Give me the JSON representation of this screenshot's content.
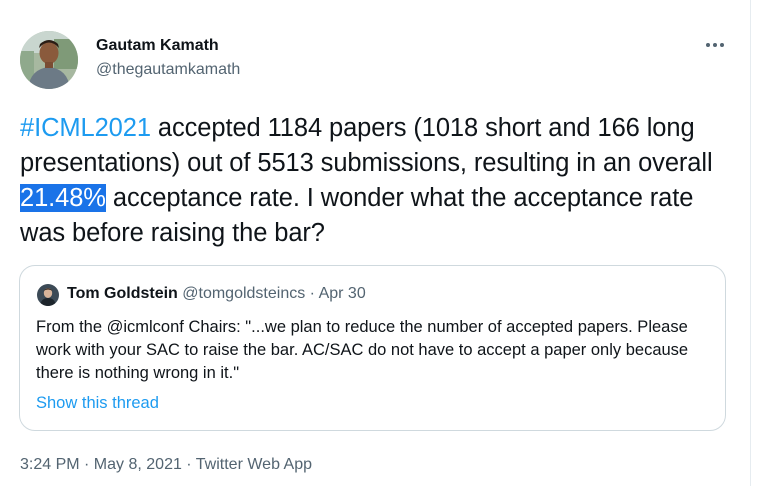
{
  "author": {
    "name": "Gautam Kamath",
    "handle": "@thegautamkamath",
    "avatar_icon": "person-photo-icon"
  },
  "more_icon": "more-dots-icon",
  "tweet": {
    "hashtag": "#ICML2021",
    "text_part1": " accepted 1184 papers (1018 short and 166 long presentations) out of 5513 submissions, resulting in an overall ",
    "highlighted": "21.48%",
    "text_part2": " acceptance rate. I wonder what the acceptance rate was before raising the bar?"
  },
  "quote": {
    "name": "Tom Goldstein",
    "handle": "@tomgoldsteincs",
    "separator": " · ",
    "date": "Apr 30",
    "text": "From the @icmlconf Chairs: \"...we plan to reduce the number of accepted papers. Please work with your SAC to raise the bar. AC/SAC do not have to accept a paper only because there is nothing wrong in it.\"",
    "show_thread": "Show this thread",
    "avatar_icon": "person-photo-icon"
  },
  "footer": {
    "timestamp": "3:24 PM · May 8, 2021 · Twitter Web App"
  },
  "colors": {
    "link": "#1d9bf0",
    "highlight": "#1a73e8",
    "secondary_text": "#536471",
    "border": "#cfd9de"
  }
}
